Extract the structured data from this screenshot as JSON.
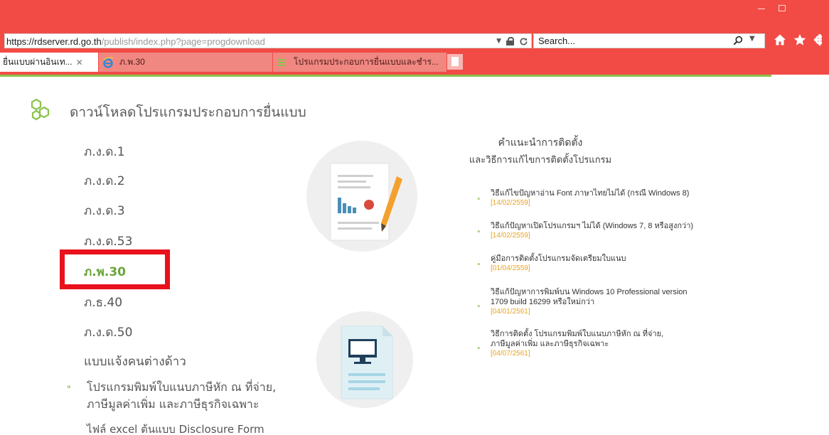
{
  "browser": {
    "url_host": "https://rdserver.rd.go.th",
    "url_path": "/publish/index.php?page=progdownload",
    "search_placeholder": "Search...",
    "tabs": [
      {
        "label": "ยื่นแบบผ่านอินเท..."
      },
      {
        "label": "ภ.พ.30"
      },
      {
        "label": "โปรแกรมประกอบการยื่นแบบและชำร..."
      }
    ]
  },
  "page": {
    "title": "ดาวน์โหลดโปรแกรมประกอบการยื่นแบบ",
    "forms": [
      {
        "label": "ภ.ง.ด.1"
      },
      {
        "label": "ภ.ง.ด.2"
      },
      {
        "label": "ภ.ง.ด.3"
      },
      {
        "label": "ภ.ง.ด.53"
      },
      {
        "label": "ภ.พ.30"
      },
      {
        "label": "ภ.ธ.40"
      },
      {
        "label": "ภ.ง.ด.50"
      }
    ],
    "foreign_form": "แบบแจ้งคนต่างด้าว",
    "program_line1": "โปรแกรมพิมพ์ใบแนบภาษีหัก ณ ที่จ่าย,",
    "program_line2": "ภาษีมูลค่าเพิ่ม และภาษีธุรกิจเฉพาะ",
    "excel_file": "ไฟล์ excel ต้นแบบ Disclosure Form"
  },
  "guide": {
    "title_line1": "คำแนะนำการติดตั้ง",
    "title_line2": "และวิธีการแก้ไขการติดตั้งโปรแกรม",
    "items": [
      {
        "line1": "วิธีแก้ไขปัญหาอ่าน Font ภาษาไทยไม่ได้ (กรณี Windows 8)",
        "line2": "",
        "date": "[14/02/2559]"
      },
      {
        "line1": "วิธีแก้ปัญหาเปิดโปรแกรมฯ ไม่ได้ (Windows 7, 8 หรือสูงกว่า)",
        "line2": "",
        "date": "[14/02/2559]"
      },
      {
        "line1": "คู่มือการติดตั้งโปรแกรมจัดเตรียมใบแนบ",
        "line2": "",
        "date": "[01/04/2559]"
      },
      {
        "line1": "วิธีแก้ปัญหาการพิมพ์บน Windows 10 Professional version",
        "line2": "1709 build 16299 หรือใหม่กว่า",
        "date": "[04/01/2561]"
      },
      {
        "line1": "วิธีการติดตั้ง โปรแกรมพิมพ์ใบแนบภาษีหัก ณ ที่จ่าย,",
        "line2": "ภาษีมูลค่าเพิ่ม และภาษีธุรกิจเฉพาะ",
        "date": "[04/07/2561]"
      }
    ]
  },
  "colors": {
    "chrome_red": "#f24b46",
    "accent_green": "#8bc34a",
    "date_orange": "#e8a321",
    "highlight_red": "#e8111c"
  },
  "icons": [
    "lock-icon",
    "refresh-icon",
    "search-icon",
    "home-icon",
    "star-icon",
    "gear-icon",
    "ie-icon",
    "page-icon",
    "hexagon-icon",
    "report-illustration",
    "monitor-document-illustration"
  ]
}
